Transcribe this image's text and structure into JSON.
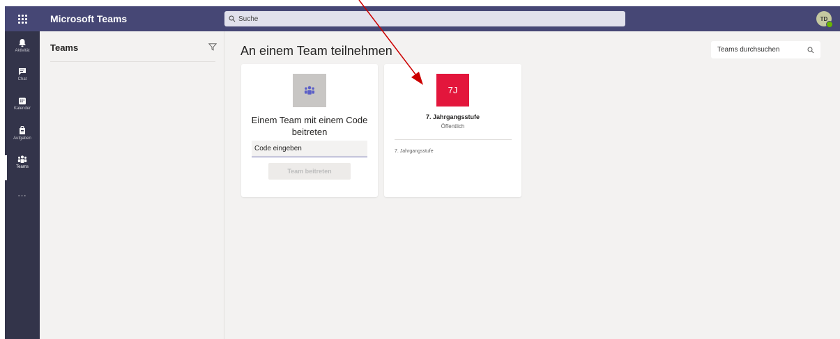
{
  "app": {
    "title": "Microsoft Teams"
  },
  "topbar": {
    "search_placeholder": "Suche",
    "avatar_initials": "TD"
  },
  "rail": {
    "items": [
      {
        "label": "Aktivität",
        "icon": "bell-icon"
      },
      {
        "label": "Chat",
        "icon": "chat-icon"
      },
      {
        "label": "Kalender",
        "icon": "calendar-icon"
      },
      {
        "label": "Aufgaben",
        "icon": "assignments-icon"
      },
      {
        "label": "Teams",
        "icon": "teams-icon",
        "active": true
      }
    ],
    "more": "..."
  },
  "panel": {
    "title": "Teams"
  },
  "main": {
    "title": "An einem Team teilnehmen",
    "search_placeholder": "Teams durchsuchen"
  },
  "code_card": {
    "title": "Einem Team mit einem Code\nbeitreten",
    "input_placeholder": "Code eingeben",
    "button_label": "Team beitreten"
  },
  "team_card": {
    "initials": "7J",
    "name": "7. Jahrgangsstufe",
    "visibility": "Öffentlich",
    "description": "7. Jahrgangsstufe",
    "color": "#e3163c"
  },
  "colors": {
    "topbar": "#464775",
    "rail": "#33344a",
    "accent": "#6264a7",
    "arrow": "#cc0000"
  }
}
